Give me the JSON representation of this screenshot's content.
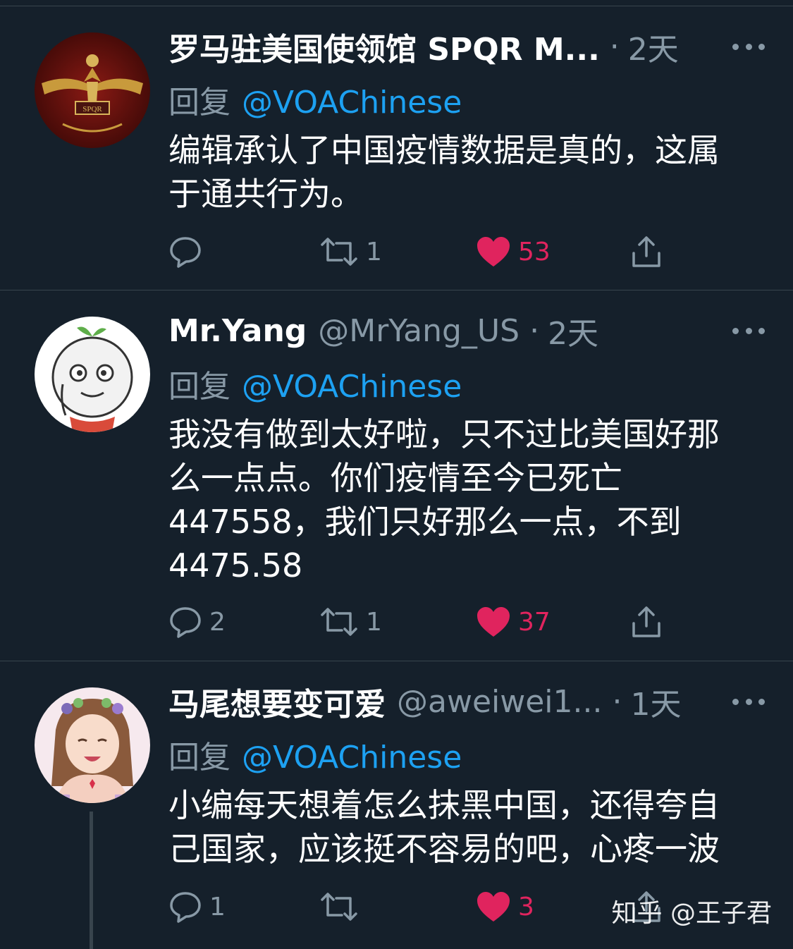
{
  "colors": {
    "background": "#15202b",
    "divider": "#38444d",
    "secondary_text": "#8899a6",
    "mention": "#1da1f2",
    "like": "#e0245e"
  },
  "tweets": [
    {
      "name": "罗马驻美国使领馆 SPQR M...",
      "handle": "",
      "dot": "·",
      "time": "2天",
      "reply_prefix": "回复",
      "reply_to": "@VOAChinese",
      "text": [
        "编辑承认了中国疫情数据是真的，这属",
        "于通共行为。"
      ],
      "replies": "",
      "retweets": "1",
      "likes": "53",
      "liked": true
    },
    {
      "name": "Mr.Yang",
      "handle": "@MrYang_US",
      "dot": "·",
      "time": "2天",
      "reply_prefix": "回复",
      "reply_to": "@VOAChinese",
      "text": [
        "我没有做到太好啦，只不过比美国好那",
        "么一点点。你们疫情至今已死亡",
        "447558，我们只好那么一点，不到",
        "4475.58"
      ],
      "replies": "2",
      "retweets": "1",
      "likes": "37",
      "liked": true
    },
    {
      "name": "马尾想要变可爱",
      "handle": "@aweiwei1...",
      "dot": "·",
      "time": "1天",
      "reply_prefix": "回复",
      "reply_to": "@VOAChinese",
      "text": [
        "小编每天想着怎么抹黑中国，还得夸自",
        "己国家，应该挺不容易的吧，心疼一波"
      ],
      "replies": "1",
      "retweets": "",
      "likes": "3",
      "liked": true
    }
  ],
  "icons": {
    "more": "more-horizontal-icon",
    "reply": "reply-bubble-icon",
    "retweet": "retweet-icon",
    "like": "heart-icon",
    "share": "share-icon"
  },
  "watermark": "知乎 @王子君"
}
